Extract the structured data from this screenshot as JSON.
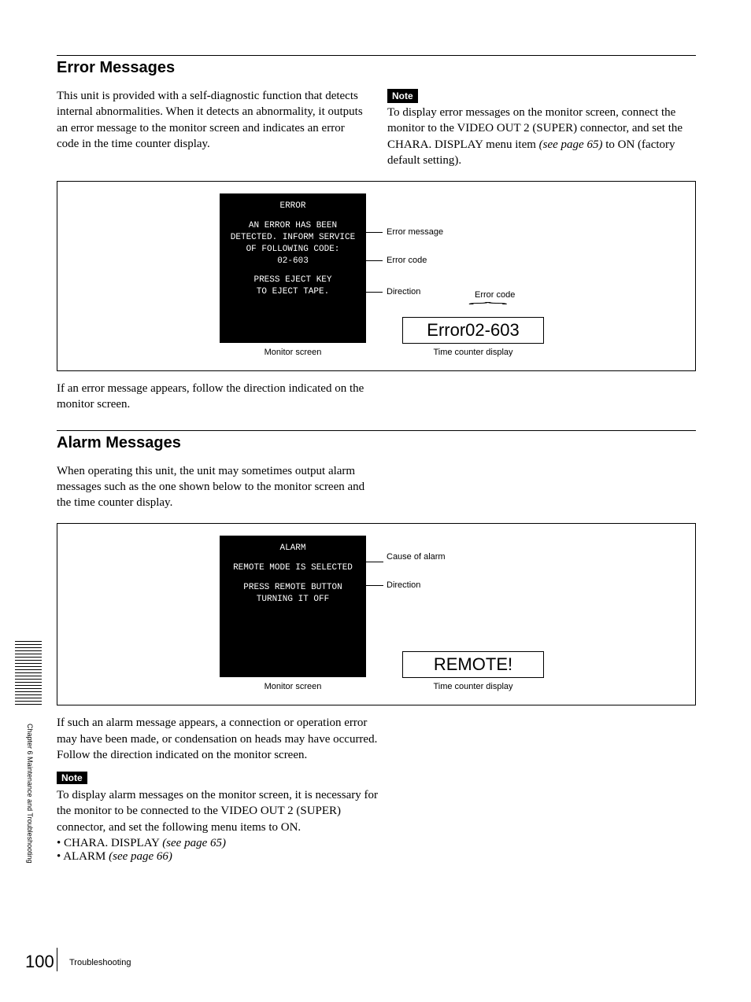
{
  "section1": {
    "heading": "Error Messages",
    "intro": "This unit is provided with a self-diagnostic function that detects internal abnormalities. When it detects an abnormality, it outputs an error message to the monitor screen and indicates an error code in the time counter display.",
    "note_label": "Note",
    "note_body_a": "To display error messages on the monitor screen, connect the monitor to the VIDEO OUT 2 (SUPER) connector, and set the CHARA. DISPLAY menu item ",
    "note_body_ref": "(see page 65)",
    "note_body_b": " to ON (factory default setting).",
    "monitor": {
      "l1": "ERROR",
      "l2a": "AN ERROR HAS BEEN",
      "l2b": "DETECTED. INFORM SERVICE",
      "l2c": "OF FOLLOWING CODE:",
      "l3": "02-603",
      "l4a": "PRESS EJECT KEY",
      "l4b": "TO EJECT TAPE."
    },
    "callouts": {
      "c1": "Error message",
      "c2": "Error code",
      "c3": "Direction",
      "c4": "Error code"
    },
    "tc_display": "Error02-603",
    "mon_caption": "Monitor screen",
    "tc_caption": "Time counter display",
    "followup": "If an error message appears, follow the direction indicated on the monitor screen."
  },
  "section2": {
    "heading": "Alarm Messages",
    "intro": "When operating this unit, the unit may sometimes output alarm messages such as the one shown below to the monitor screen and the time counter display.",
    "monitor": {
      "l1": "ALARM",
      "l2": "REMOTE MODE IS SELECTED",
      "l3a": "PRESS REMOTE BUTTON",
      "l3b": "TURNING IT OFF"
    },
    "callouts": {
      "c1": "Cause of alarm",
      "c2": "Direction"
    },
    "tc_display": "REMOTE!",
    "mon_caption": "Monitor screen",
    "tc_caption": "Time counter display",
    "followup": "If such an alarm message appears, a connection or operation error may have been made, or condensation on heads may have occurred. Follow the direction indicated on the monitor screen.",
    "note_label": "Note",
    "note_body": "To display alarm messages on the monitor screen, it is necessary for the monitor to be connected to the VIDEO OUT 2 (SUPER) connector, and set the following menu items to ON.",
    "bullet1a": "CHARA. DISPLAY ",
    "bullet1b": "(see page 65)",
    "bullet2a": "ALARM ",
    "bullet2b": "(see page 66)"
  },
  "side": {
    "chapter": "Chapter 6  Maintenance and Troubleshooting"
  },
  "footer": {
    "page": "100",
    "section": "Troubleshooting"
  }
}
